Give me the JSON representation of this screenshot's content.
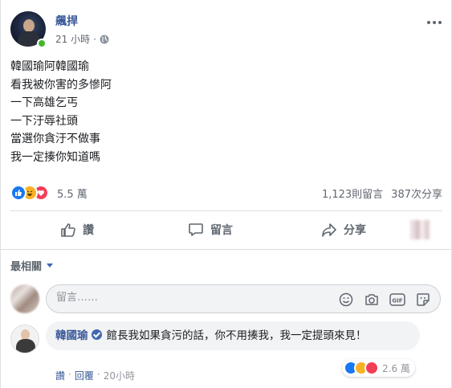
{
  "post": {
    "author": "飆捍",
    "time": "21 小時",
    "lines": [
      "韓國瑜阿韓國瑜",
      "看我被你害的多慘阿",
      "一下高雄乞丐",
      "一下汙辱社頭",
      "當選你貪汙不做事",
      "我一定揍你知道嗎"
    ]
  },
  "stats": {
    "reactions": "5.5 萬",
    "comments": "1,123則留言",
    "shares": "387次分享"
  },
  "actions": {
    "like": "讚",
    "comment": "留言",
    "share": "分享"
  },
  "comments_section": {
    "filter": "最相關",
    "placeholder": "留言……"
  },
  "top_comment": {
    "author": "韓國瑜",
    "text": "館長我如果貪污的話，你不用揍我，我一定提頭來見！",
    "like": "讚",
    "reply": "回覆",
    "time": "20小時",
    "reactions": "2.6 萬"
  },
  "colors": {
    "link": "#385898",
    "like": "#1877f2",
    "haha": "#f7b125",
    "love": "#f33e58",
    "online": "#42b72a"
  }
}
